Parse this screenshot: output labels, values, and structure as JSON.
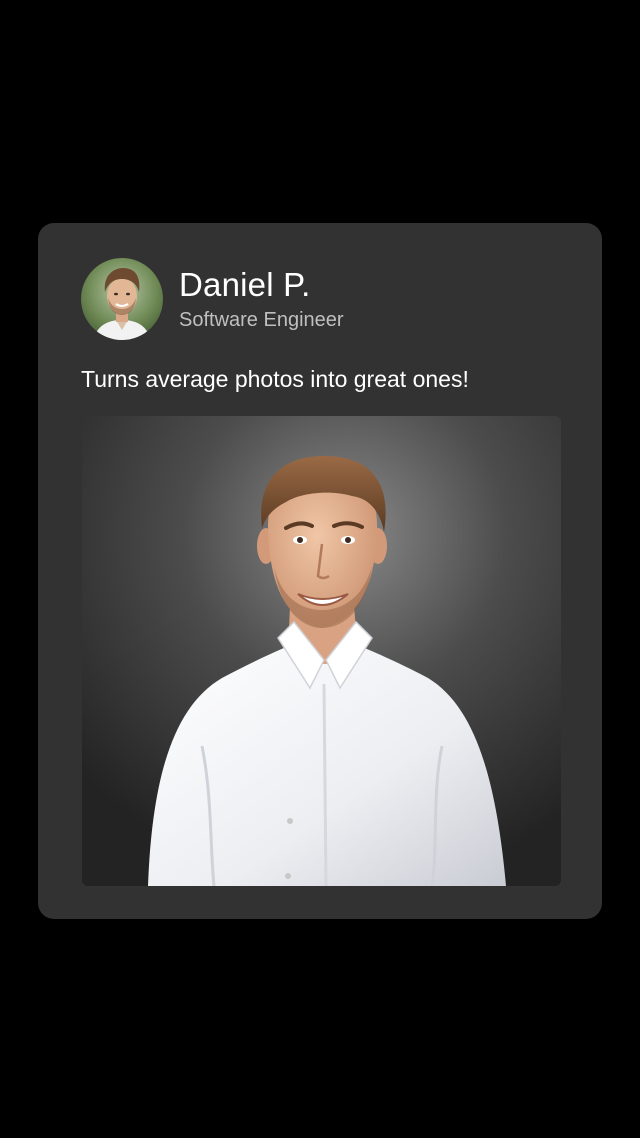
{
  "profile": {
    "name": "Daniel P.",
    "title": "Software Engineer"
  },
  "post": {
    "caption": "Turns average photos into great ones!"
  },
  "colors": {
    "background": "#000000",
    "card": "#323232",
    "name_text": "#ffffff",
    "title_text": "#bfbfbf",
    "shirt": "#f4f4f6",
    "hair": "#7a5234"
  }
}
